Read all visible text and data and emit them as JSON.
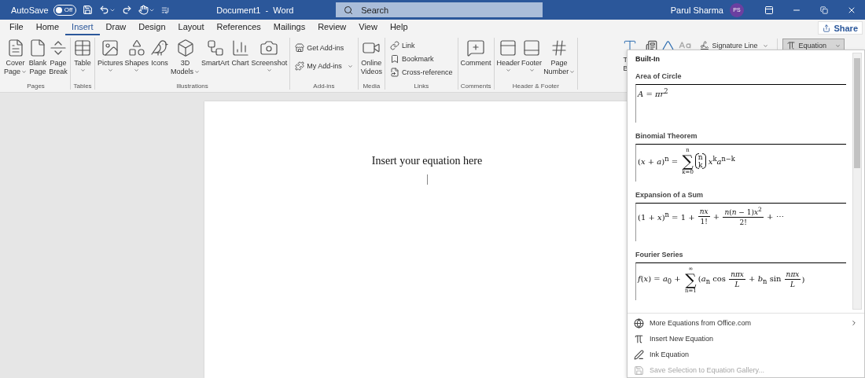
{
  "title_bar": {
    "autosave_label": "AutoSave",
    "autosave_toggle": {
      "label": "Off",
      "on": false
    },
    "document_title": "Document1  -  Word",
    "search": {
      "placeholder": "Search"
    },
    "user_name": "Parul Sharma",
    "avatar_initials": "PS"
  },
  "tabs": [
    {
      "label": "File",
      "selected": false
    },
    {
      "label": "Home",
      "selected": false
    },
    {
      "label": "Insert",
      "selected": true
    },
    {
      "label": "Draw",
      "selected": false
    },
    {
      "label": "Design",
      "selected": false
    },
    {
      "label": "Layout",
      "selected": false
    },
    {
      "label": "References",
      "selected": false
    },
    {
      "label": "Mailings",
      "selected": false
    },
    {
      "label": "Review",
      "selected": false
    },
    {
      "label": "View",
      "selected": false
    },
    {
      "label": "Help",
      "selected": false
    }
  ],
  "share_button": "Share",
  "ribbon_groups": [
    {
      "name": "Pages",
      "buttons": [
        {
          "kind": "large",
          "label": [
            "Cover",
            "Page"
          ],
          "dropdown": true
        },
        {
          "kind": "large",
          "label": [
            "Blank",
            "Page"
          ],
          "dropdown": false
        },
        {
          "kind": "large",
          "label": [
            "Page",
            "Break"
          ],
          "dropdown": false
        }
      ]
    },
    {
      "name": "Tables",
      "buttons": [
        {
          "kind": "large",
          "label": [
            "Table"
          ],
          "dropdown": true
        }
      ]
    },
    {
      "name": "Illustrations",
      "buttons": [
        {
          "kind": "large",
          "label": [
            "Pictures"
          ],
          "dropdown": true
        },
        {
          "kind": "large",
          "label": [
            "Shapes"
          ],
          "dropdown": true
        },
        {
          "kind": "large",
          "label": [
            "Icons"
          ],
          "dropdown": false
        },
        {
          "kind": "large",
          "label": [
            "3D",
            "Models"
          ],
          "dropdown": true
        },
        {
          "kind": "large",
          "label": [
            "SmartArt"
          ],
          "dropdown": false
        },
        {
          "kind": "large",
          "label": [
            "Chart"
          ],
          "dropdown": false
        },
        {
          "kind": "large",
          "label": [
            "Screenshot"
          ],
          "dropdown": true
        }
      ]
    },
    {
      "name": "Add-ins",
      "buttons": [
        {
          "kind": "small",
          "label": [
            "Get Add-ins"
          ],
          "dropdown": false
        },
        {
          "kind": "small",
          "label": [
            "My Add-ins"
          ],
          "dropdown": true
        }
      ]
    },
    {
      "name": "Media",
      "buttons": [
        {
          "kind": "large",
          "label": [
            "Online",
            "Videos"
          ],
          "dropdown": false
        }
      ]
    },
    {
      "name": "Links",
      "buttons": [
        {
          "kind": "small",
          "label": [
            "Link"
          ],
          "dropdown": false
        },
        {
          "kind": "small",
          "label": [
            "Bookmark"
          ],
          "dropdown": false
        },
        {
          "kind": "small",
          "label": [
            "Cross-reference"
          ],
          "dropdown": false
        }
      ]
    },
    {
      "name": "Comments",
      "buttons": [
        {
          "kind": "large",
          "label": [
            "Comment"
          ],
          "dropdown": false
        }
      ]
    },
    {
      "name": "Header & Footer",
      "buttons": [
        {
          "kind": "large",
          "label": [
            "Header"
          ],
          "dropdown": true
        },
        {
          "kind": "large",
          "label": [
            "Footer"
          ],
          "dropdown": true
        },
        {
          "kind": "large",
          "label": [
            "Page",
            "Number"
          ],
          "dropdown": true
        }
      ]
    }
  ],
  "text_group": {
    "text_box_label": [
      "T",
      "B"
    ],
    "signature_line": {
      "label": "Signature Line",
      "dropdown": true
    },
    "equation": {
      "label": "Equation",
      "dropdown": true,
      "selected": true
    }
  },
  "document": {
    "text": "Insert your equation here"
  },
  "equation_menu": {
    "section": "Built-In",
    "items": [
      {
        "title": "Area of Circle",
        "equation": [
          {
            "kind": "text",
            "text": "*A* = *πr*$^{2}$"
          }
        ]
      },
      {
        "title": "Binomial Theorem",
        "equation": [
          {
            "kind": "text",
            "text": "(*x* + *a*)$^{n}$ = "
          },
          {
            "kind": "sum",
            "symbol": "∑",
            "over": "n",
            "under": "k=0"
          },
          {
            "kind": "binom",
            "top": "n",
            "bottom": "k"
          },
          {
            "kind": "text",
            "text": " *x*$^{k}$*a*$^{n−k}$"
          }
        ]
      },
      {
        "title": "Expansion of a Sum",
        "equation": [
          {
            "kind": "text",
            "text": "(1 + *x*)$^{n}$ = 1 + "
          },
          {
            "kind": "frac",
            "num": "*nx*",
            "den": "1!"
          },
          {
            "kind": "text",
            "text": " + "
          },
          {
            "kind": "frac",
            "num": "*n*(*n* − 1)*x*$^{2}$",
            "den": "2!"
          },
          {
            "kind": "text",
            "text": " + ⋯"
          }
        ]
      },
      {
        "title": "Fourier Series",
        "equation": [
          {
            "kind": "text",
            "text": "*f*(*x*) = *a*$_{0}$ + "
          },
          {
            "kind": "sum",
            "symbol": "∑",
            "over": "∞",
            "under": "n=1"
          },
          {
            "kind": "text",
            "text": "(*a*$_{n}$ cos "
          },
          {
            "kind": "frac",
            "num": "*nπx*",
            "den": "*L*"
          },
          {
            "kind": "text",
            "text": " + *b*$_{n}$ sin "
          },
          {
            "kind": "frac",
            "num": "*nπx*",
            "den": "*L*"
          },
          {
            "kind": "text",
            "text": ")"
          }
        ]
      }
    ],
    "commands": [
      {
        "label": "More Equations from Office.com",
        "submenu": true,
        "disabled": false
      },
      {
        "label": "Insert New Equation",
        "submenu": false,
        "disabled": false
      },
      {
        "label": "Ink Equation",
        "submenu": false,
        "disabled": false
      },
      {
        "label": "Save Selection to Equation Gallery...",
        "submenu": false,
        "disabled": true
      }
    ]
  }
}
